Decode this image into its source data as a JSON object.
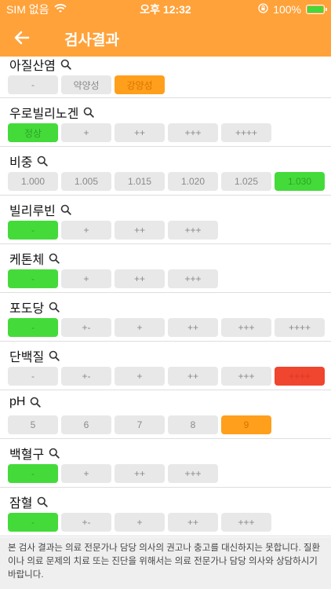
{
  "status_bar": {
    "carrier": "SIM 없음",
    "time": "오후 12:32",
    "battery": "100%",
    "battery_level": 100,
    "icons": [
      "wifi-icon",
      "rotation-lock-icon",
      "battery-icon"
    ]
  },
  "nav": {
    "title": "검사결과",
    "back_icon": "arrow-left-icon"
  },
  "colors": {
    "header": "#FFA23A",
    "green": "#44DB3A",
    "orange": "#FF9F1C",
    "red": "#F0452E",
    "inactive": "#e8e8e8"
  },
  "sections": [
    {
      "title": "아질산염",
      "options": [
        {
          "label": "-",
          "state": "off"
        },
        {
          "label": "약양성",
          "state": "off"
        },
        {
          "label": "강양성",
          "state": "orange"
        }
      ]
    },
    {
      "title": "우로빌리노겐",
      "options": [
        {
          "label": "정상",
          "state": "green"
        },
        {
          "label": "+",
          "state": "off"
        },
        {
          "label": "++",
          "state": "off"
        },
        {
          "label": "+++",
          "state": "off"
        },
        {
          "label": "++++",
          "state": "off"
        }
      ]
    },
    {
      "title": "비중",
      "options": [
        {
          "label": "1.000",
          "state": "off"
        },
        {
          "label": "1.005",
          "state": "off"
        },
        {
          "label": "1.015",
          "state": "off"
        },
        {
          "label": "1.020",
          "state": "off"
        },
        {
          "label": "1.025",
          "state": "off"
        },
        {
          "label": "1.030",
          "state": "green"
        }
      ]
    },
    {
      "title": "빌리루빈",
      "options": [
        {
          "label": "-",
          "state": "green"
        },
        {
          "label": "+",
          "state": "off"
        },
        {
          "label": "++",
          "state": "off"
        },
        {
          "label": "+++",
          "state": "off"
        }
      ]
    },
    {
      "title": "케톤체",
      "options": [
        {
          "label": "-",
          "state": "green"
        },
        {
          "label": "+",
          "state": "off"
        },
        {
          "label": "++",
          "state": "off"
        },
        {
          "label": "+++",
          "state": "off"
        }
      ]
    },
    {
      "title": "포도당",
      "options": [
        {
          "label": "-",
          "state": "green"
        },
        {
          "label": "+-",
          "state": "off"
        },
        {
          "label": "+",
          "state": "off"
        },
        {
          "label": "++",
          "state": "off"
        },
        {
          "label": "+++",
          "state": "off"
        },
        {
          "label": "++++",
          "state": "off"
        }
      ]
    },
    {
      "title": "단백질",
      "options": [
        {
          "label": "-",
          "state": "off"
        },
        {
          "label": "+-",
          "state": "off"
        },
        {
          "label": "+",
          "state": "off"
        },
        {
          "label": "++",
          "state": "off"
        },
        {
          "label": "+++",
          "state": "off"
        },
        {
          "label": "++++",
          "state": "red"
        }
      ]
    },
    {
      "title": "pH",
      "options": [
        {
          "label": "5",
          "state": "off"
        },
        {
          "label": "6",
          "state": "off"
        },
        {
          "label": "7",
          "state": "off"
        },
        {
          "label": "8",
          "state": "off"
        },
        {
          "label": "9",
          "state": "orange"
        }
      ]
    },
    {
      "title": "백혈구",
      "options": [
        {
          "label": "-",
          "state": "green"
        },
        {
          "label": "+",
          "state": "off"
        },
        {
          "label": "++",
          "state": "off"
        },
        {
          "label": "+++",
          "state": "off"
        }
      ]
    },
    {
      "title": "잠혈",
      "options": [
        {
          "label": "-",
          "state": "green"
        },
        {
          "label": "+-",
          "state": "off"
        },
        {
          "label": "+",
          "state": "off"
        },
        {
          "label": "++",
          "state": "off"
        },
        {
          "label": "+++",
          "state": "off"
        }
      ]
    }
  ],
  "disclaimer": "본 검사 결과는 의료 전문가나 담당 의사의 권고나 충고를 대신하지는 못합니다. 질환이나 의료 문제의 치료 또는 진단을 위해서는 의료 전문가나 담당 의사와 상담하시기 바랍니다."
}
